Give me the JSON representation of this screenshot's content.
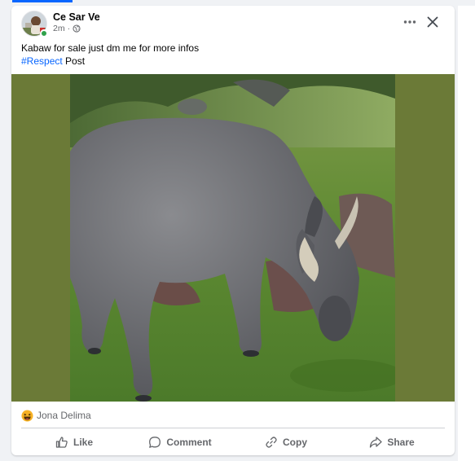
{
  "post": {
    "author": "Ce Sar Ve",
    "time": "2m",
    "meta_separator": "·",
    "privacy_icon": "globe-icon",
    "text_line1": "Kabaw for sale just dm me for more infos",
    "hashtag": "#Respect",
    "text_line2_rest": " Post",
    "image_subject": "water buffalo (carabao) grazing on grass"
  },
  "reactions": {
    "emoji": "haha-reaction-icon",
    "names": "Jona Delima"
  },
  "actions": {
    "like": "Like",
    "comment": "Comment",
    "copy": "Copy",
    "share": "Share"
  },
  "colors": {
    "accent": "#0866ff",
    "online": "#31a24c",
    "secondary_text": "#65676b",
    "media_background": "#6b7a37"
  }
}
